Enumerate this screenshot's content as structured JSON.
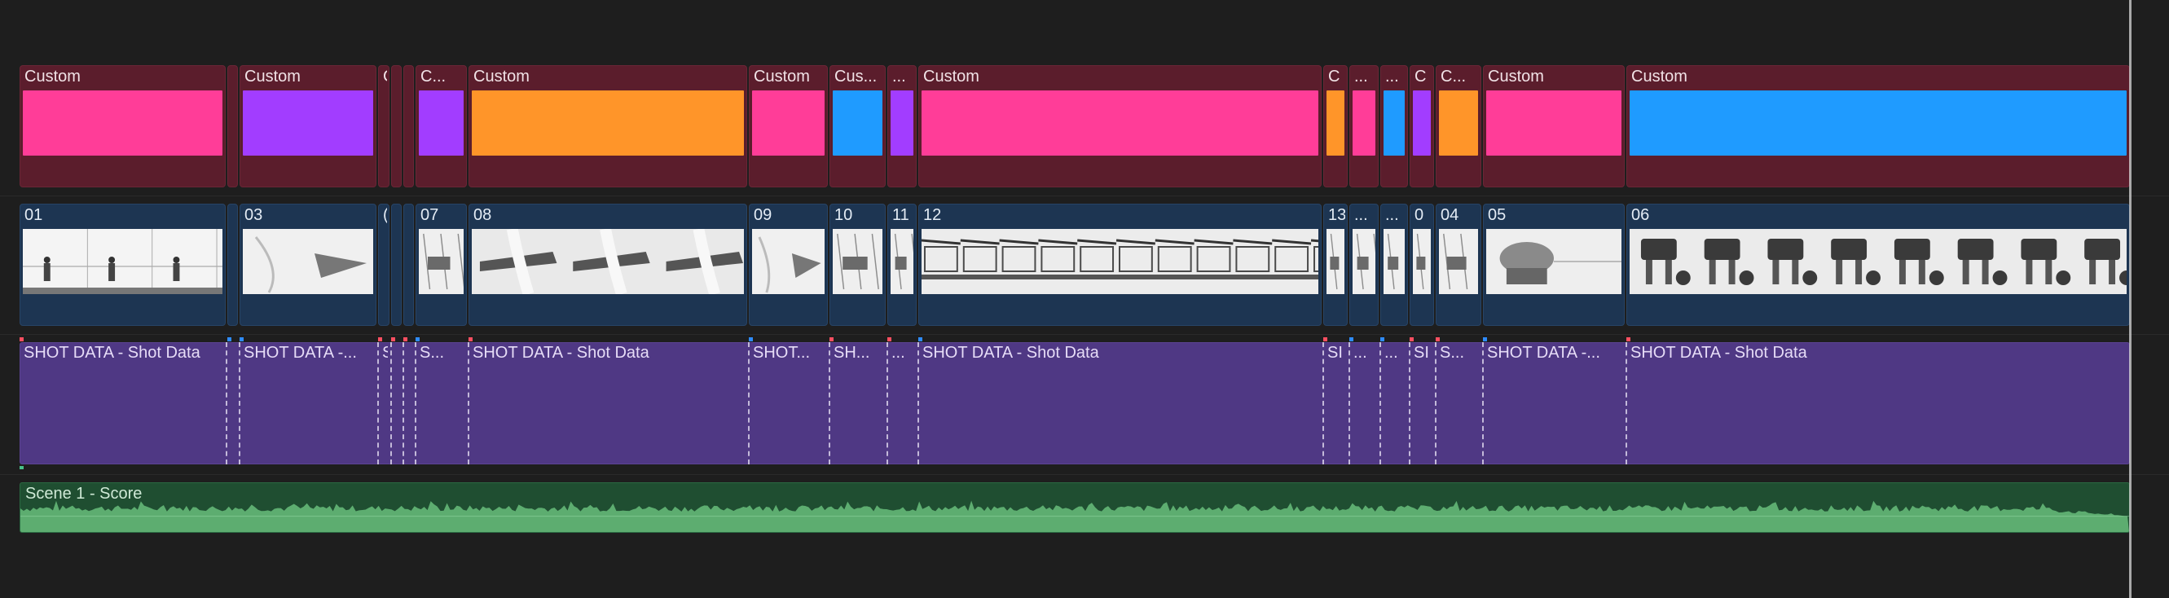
{
  "colors": {
    "pink": "#ff3d98",
    "purple": "#a23dff",
    "orange": "#ff9529",
    "blue": "#1f9bff",
    "color_lane_bg": "#5b1d2c",
    "video_lane_bg": "#1d3552",
    "data_lane_bg": "#4f3884",
    "audio_lane_bg": "#1f4e31",
    "waveform": "#64b878",
    "marker_red": "#ff4f61",
    "marker_blue": "#2e8cff"
  },
  "color_lane": {
    "clips": [
      {
        "label": "Custom",
        "color": "pink"
      },
      {
        "label": "",
        "color": "none"
      },
      {
        "label": "Custom",
        "color": "purple"
      },
      {
        "label": "C",
        "color": "none"
      },
      {
        "label": "",
        "color": "none"
      },
      {
        "label": "",
        "color": "none"
      },
      {
        "label": "C...",
        "color": "purple"
      },
      {
        "label": "Custom",
        "color": "orange"
      },
      {
        "label": "Custom",
        "color": "pink"
      },
      {
        "label": "Cus...",
        "color": "blue"
      },
      {
        "label": "...",
        "color": "purple"
      },
      {
        "label": "Custom",
        "color": "pink"
      },
      {
        "label": "C",
        "color": "orange"
      },
      {
        "label": "...",
        "color": "pink"
      },
      {
        "label": "...",
        "color": "blue"
      },
      {
        "label": "C",
        "color": "purple"
      },
      {
        "label": "C...",
        "color": "orange"
      },
      {
        "label": "Custom",
        "color": "pink"
      },
      {
        "label": "Custom",
        "color": "blue"
      }
    ]
  },
  "video_lane": {
    "clips": [
      {
        "label": "01",
        "thumb": "figures"
      },
      {
        "label": "",
        "thumb": "none"
      },
      {
        "label": "03",
        "thumb": "ship"
      },
      {
        "label": "(",
        "thumb": "none"
      },
      {
        "label": "",
        "thumb": "none"
      },
      {
        "label": "",
        "thumb": "none"
      },
      {
        "label": "07",
        "thumb": "sketch"
      },
      {
        "label": "08",
        "thumb": "destroyer"
      },
      {
        "label": "09",
        "thumb": "ship"
      },
      {
        "label": "10",
        "thumb": "sketch"
      },
      {
        "label": "11",
        "thumb": "sketch"
      },
      {
        "label": "12",
        "thumb": "hull"
      },
      {
        "label": "13",
        "thumb": "sketch"
      },
      {
        "label": "...",
        "thumb": "sketch"
      },
      {
        "label": "...",
        "thumb": "sketch"
      },
      {
        "label": "0",
        "thumb": "sketch"
      },
      {
        "label": "04",
        "thumb": "sketch"
      },
      {
        "label": "05",
        "thumb": "tank"
      },
      {
        "label": "06",
        "thumb": "walkers"
      }
    ]
  },
  "data_lane": {
    "clips": [
      {
        "label": "SHOT DATA - Shot Data"
      },
      {
        "label": ""
      },
      {
        "label": "SHOT DATA -..."
      },
      {
        "label": "S"
      },
      {
        "label": ""
      },
      {
        "label": ""
      },
      {
        "label": "S..."
      },
      {
        "label": "SHOT DATA - Shot Data"
      },
      {
        "label": "SHOT..."
      },
      {
        "label": "SH..."
      },
      {
        "label": "..."
      },
      {
        "label": "SHOT DATA - Shot Data"
      },
      {
        "label": "SI"
      },
      {
        "label": "..."
      },
      {
        "label": "..."
      },
      {
        "label": "SI"
      },
      {
        "label": "S..."
      },
      {
        "label": "SHOT DATA -..."
      },
      {
        "label": "SHOT DATA - Shot Data"
      }
    ]
  },
  "audio_lane": {
    "clip": {
      "label": "Scene 1 - Score"
    }
  }
}
